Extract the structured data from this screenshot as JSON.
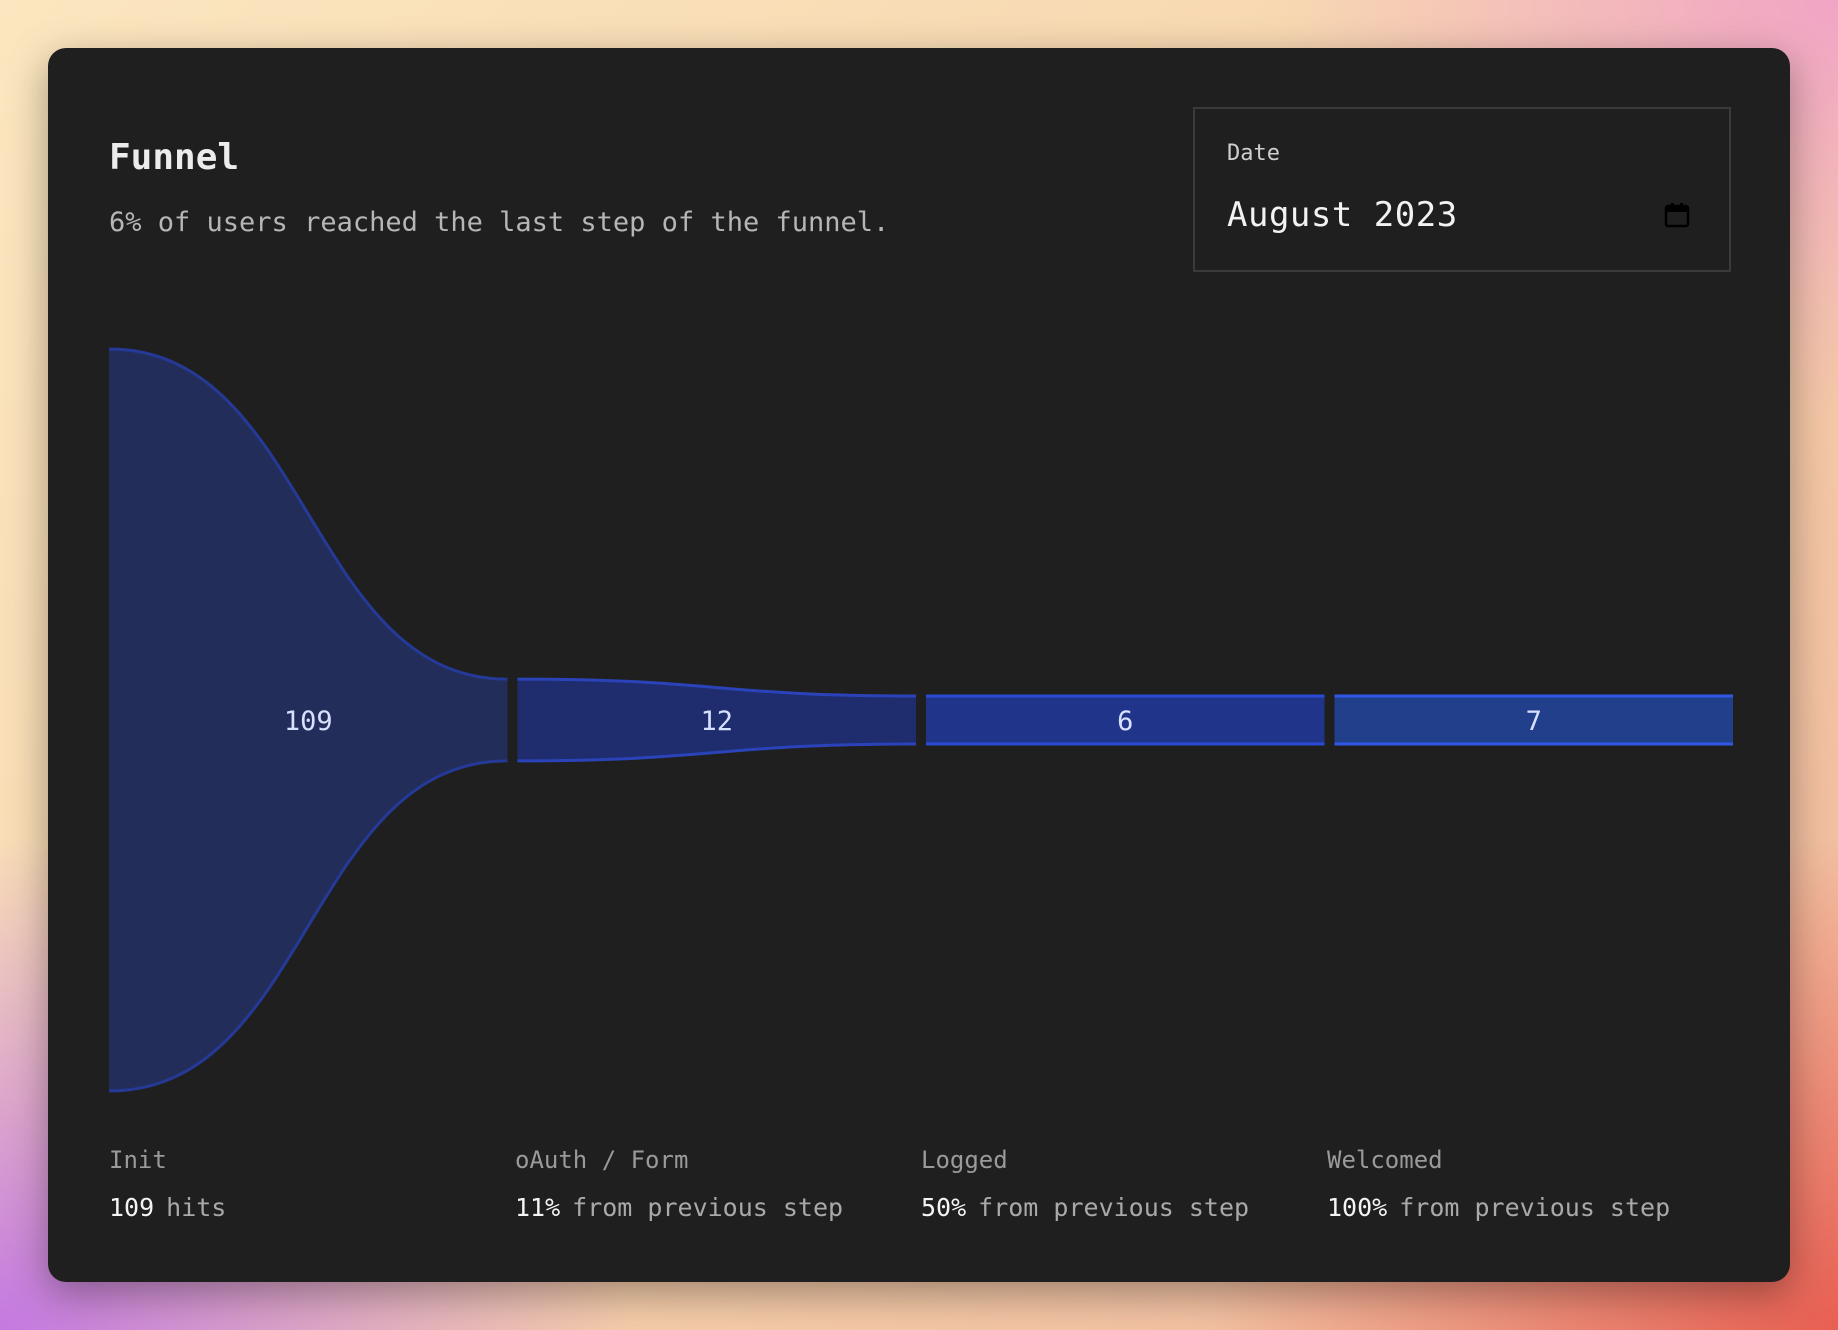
{
  "header": {
    "title": "Funnel",
    "subtitle": "6% of users reached the last step of the funnel."
  },
  "date_picker": {
    "label": "Date",
    "value": "August 2023",
    "icon": "calendar-icon"
  },
  "steps": [
    {
      "label": "Init",
      "metric_value": "109",
      "metric_suffix": "hits"
    },
    {
      "label": "oAuth / Form",
      "metric_value": "11%",
      "metric_suffix": "from previous step"
    },
    {
      "label": "Logged",
      "metric_value": "50%",
      "metric_suffix": "from previous step"
    },
    {
      "label": "Welcomed",
      "metric_value": "100%",
      "metric_suffix": "from previous step"
    }
  ],
  "chart_data": {
    "type": "area",
    "categories": [
      "Init",
      "oAuth / Form",
      "Logged",
      "Welcomed"
    ],
    "values": [
      109,
      12,
      6,
      7
    ],
    "value_labels": [
      "109",
      "12",
      "6",
      "7"
    ],
    "colors": {
      "fill": [
        "#232d5a",
        "#1f2c6e",
        "#20348a",
        "#223f8c"
      ],
      "stroke": [
        "#243a96",
        "#2a43b8",
        "#2b4bd4",
        "#2f58e6"
      ],
      "label": "#d8e0ff",
      "card_background": "#1f1f20"
    }
  }
}
